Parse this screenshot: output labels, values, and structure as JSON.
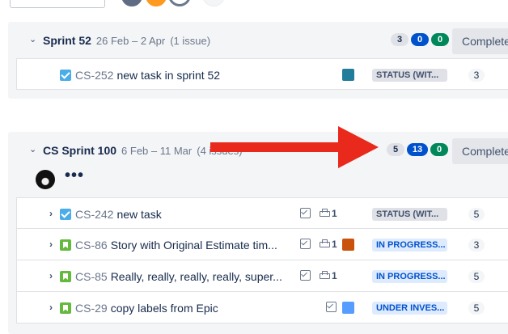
{
  "sprints": [
    {
      "name": "Sprint 52",
      "dates": "26 Feb – 2 Apr",
      "count": "(1 issue)",
      "pills": {
        "todo": "3",
        "progress": "0",
        "done": "0"
      },
      "complete_label": "Complete",
      "issues": [
        {
          "key": "CS-252",
          "summary": "new task in sprint 52",
          "type": "task",
          "epic_color": "#227d9b",
          "status": "STATUS (WIT...",
          "estimate": "3"
        }
      ]
    },
    {
      "name": "CS Sprint 100",
      "dates": "6 Feb – 11 Mar",
      "count": "(4 issues)",
      "pills": {
        "todo": "5",
        "progress": "13",
        "done": "0"
      },
      "complete_label": "Complete",
      "issues": [
        {
          "key": "CS-242",
          "summary": "new task",
          "type": "task",
          "child_count": "1",
          "status": "STATUS (WIT...",
          "estimate": "5"
        },
        {
          "key": "CS-86",
          "summary": "Story with Original Estimate tim...",
          "type": "story",
          "child_count": "1",
          "epic_color": "#c9530d",
          "status": "IN PROGRESS...",
          "estimate": "3"
        },
        {
          "key": "CS-85",
          "summary": "Really, really, really, really, super...",
          "type": "story",
          "child_count": "1",
          "status": "IN PROGRESS...",
          "estimate": "5"
        },
        {
          "key": "CS-29",
          "summary": "copy labels from Epic",
          "type": "story",
          "epic_color": "#579dff",
          "status": "UNDER INVES...",
          "estimate": "5"
        }
      ]
    }
  ],
  "annotation": {
    "color": "#e8291c"
  },
  "more_label": "•••"
}
